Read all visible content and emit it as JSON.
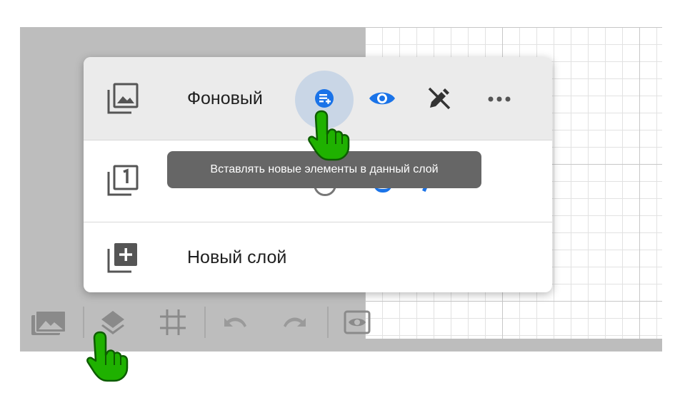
{
  "layers_panel": {
    "layers": [
      {
        "name": "Фоновый",
        "icon": "background-layer-icon",
        "active": true
      },
      {
        "name": "",
        "icon": "layer-1-icon",
        "active": false
      }
    ],
    "new_layer_label": "Новый слой",
    "actions": [
      "insert-into-layer-icon",
      "visibility-eye-icon",
      "lock-edit-icon",
      "more-options-icon"
    ]
  },
  "tooltip": {
    "text": "Вставлять новые элементы в данный слой"
  },
  "toolbar": {
    "buttons": [
      "backgrounds-icon",
      "layers-icon",
      "grid-icon",
      "undo-icon",
      "redo-icon",
      "preview-icon"
    ]
  },
  "colors": {
    "accent": "#1a73e8",
    "workspace": "#bdbdbd",
    "tooltip": "#666666",
    "cursor": "#1fb100"
  }
}
